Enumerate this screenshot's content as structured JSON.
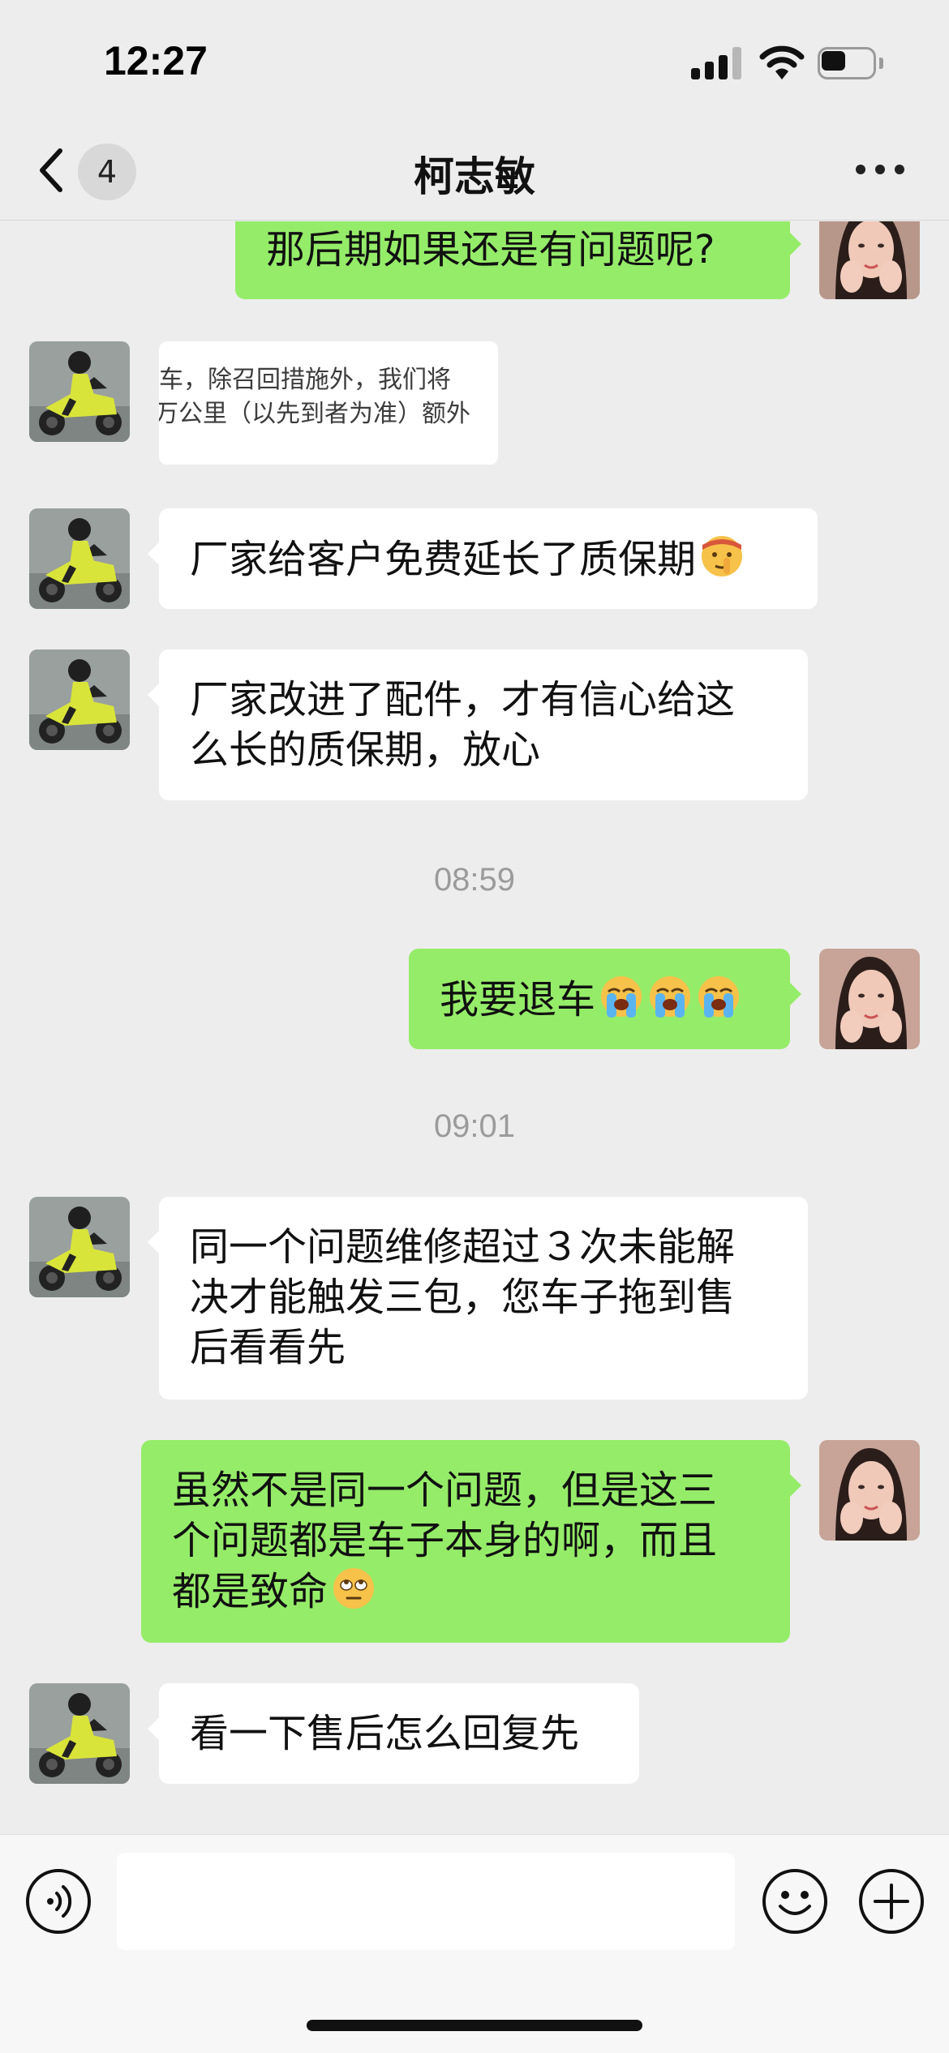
{
  "status_bar": {
    "time": "12:27"
  },
  "nav": {
    "unread_count": "4",
    "title": "柯志敏"
  },
  "messages": {
    "m1": {
      "lines": [
        "那后期如果还是有问题呢?"
      ]
    },
    "m2": {
      "lines": [
        "车，除召回措施外，我们将",
        "万公里（以先到者为准）额外"
      ]
    },
    "m3": {
      "lines": [
        "厂家给客户免费延长了质保期"
      ],
      "emoji": "shushing-face-emoji"
    },
    "m4": {
      "lines": [
        "厂家改进了配件，才有信心给这",
        "么长的质保期，放心"
      ]
    },
    "t1": "08:59",
    "m5": {
      "lines": [
        "我要退车"
      ],
      "emoji": "loudly-crying-face-emoji"
    },
    "t2": "09:01",
    "m6": {
      "lines": [
        "同一个问题维修超过３次未能解",
        "决才能触发三包，您车子拖到售",
        "后看看先"
      ]
    },
    "m7": {
      "lines": [
        "虽然不是同一个问题，但是这三",
        "个问题都是车子本身的啊，而且",
        "都是致命"
      ],
      "emoji": "face-with-rolling-eyes-emoji"
    },
    "m8": {
      "lines": [
        "看一下售后怎么回复先"
      ]
    }
  },
  "colors": {
    "incoming_bubble": "#ffffff",
    "outgoing_bubble": "#95ec69",
    "background": "#ededed"
  }
}
